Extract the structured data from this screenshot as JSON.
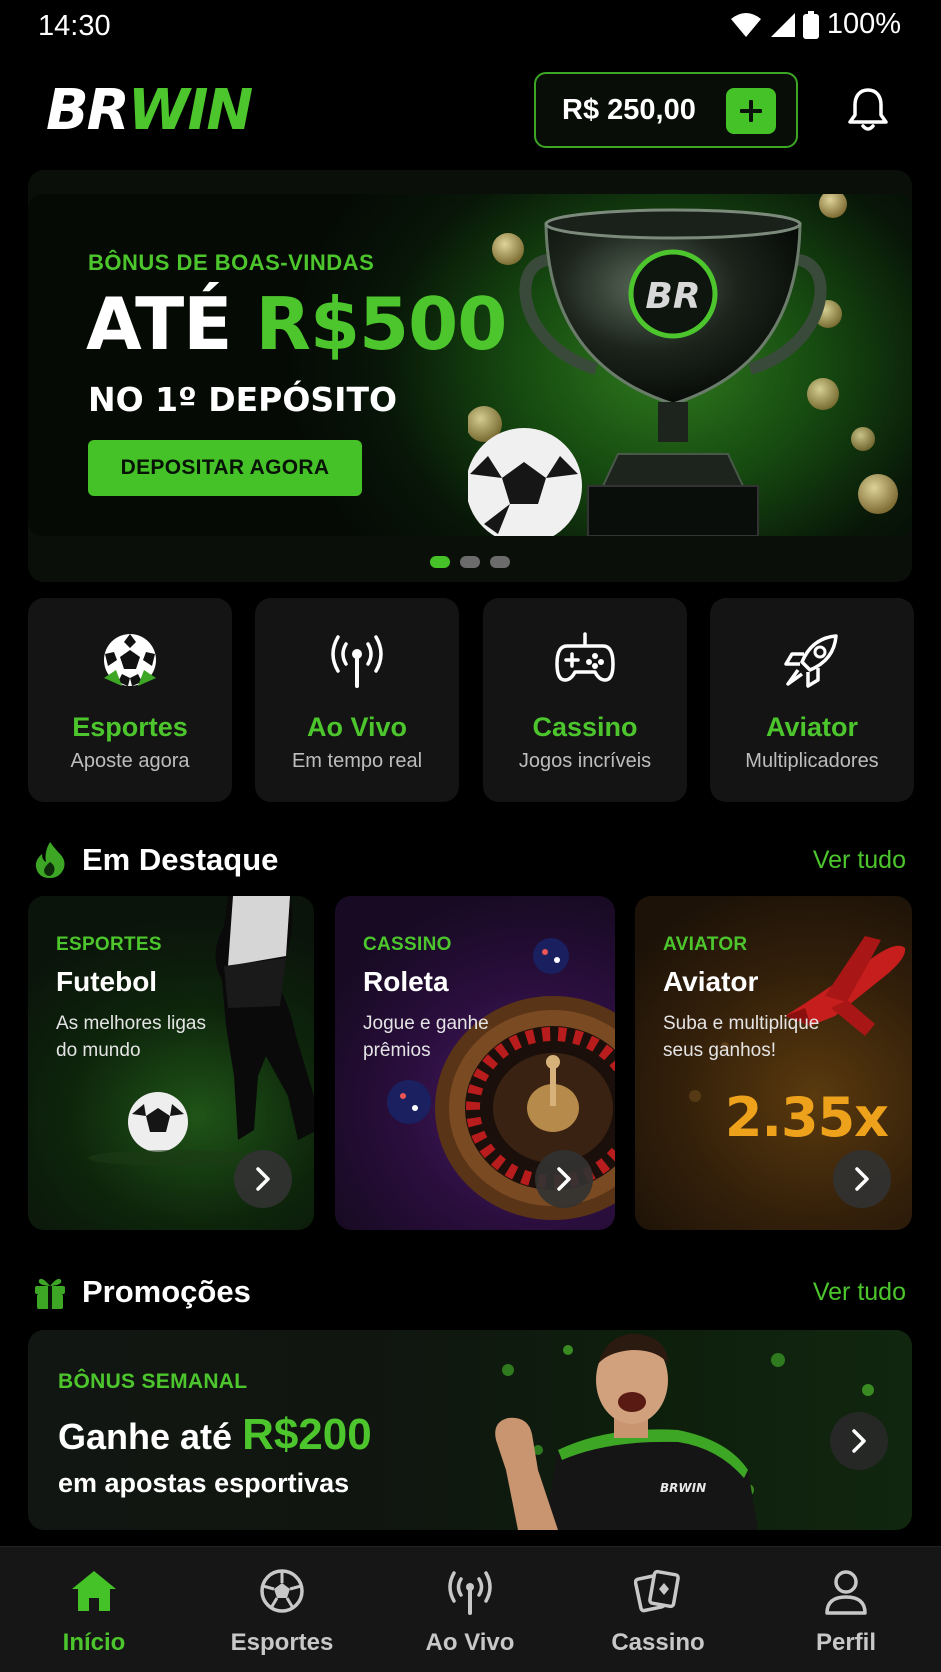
{
  "status_bar": {
    "time": "14:30",
    "battery": "100%"
  },
  "header": {
    "logo_part1": "BR",
    "logo_part2": "WIN",
    "balance": "R$ 250,00",
    "add_funds_label": "+",
    "notifications_icon": "bell-icon"
  },
  "hero": {
    "eyebrow": "BÔNUS DE BOAS-VINDAS",
    "headline_prefix": "ATÉ ",
    "headline_amount": "R$500",
    "subline": "NO 1º DEPÓSITO",
    "cta": "DEPOSITAR AGORA",
    "trophy_badge": "BR",
    "carousel": {
      "total": 3,
      "active": 1
    }
  },
  "categories": [
    {
      "name": "Esportes",
      "desc": "Aposte agora",
      "icon": "soccer-ball-icon"
    },
    {
      "name": "Ao Vivo",
      "desc": "Em tempo real",
      "icon": "broadcast-icon"
    },
    {
      "name": "Cassino",
      "desc": "Jogos incríveis",
      "icon": "gamepad-icon"
    },
    {
      "name": "Aviator",
      "desc": "Multiplicadores",
      "icon": "rocket-icon"
    }
  ],
  "featured": {
    "title": "Em Destaque",
    "see_all": "Ver tudo",
    "cards": [
      {
        "eyebrow": "ESPORTES",
        "title": "Futebol",
        "desc": "As melhores ligas do mundo"
      },
      {
        "eyebrow": "CASSINO",
        "title": "Roleta",
        "desc": "Jogue e ganhe prêmios"
      },
      {
        "eyebrow": "AVIATOR",
        "title": "Aviator",
        "desc": "Suba e multiplique seus ganhos!",
        "multiplier": "2.35x"
      }
    ]
  },
  "promotions": {
    "title": "Promoções",
    "see_all": "Ver tudo",
    "card": {
      "eyebrow": "BÔNUS SEMANAL",
      "title_prefix": "Ganhe até ",
      "title_amount": "R$200",
      "desc": "em apostas esportivas",
      "shirt_logo": "BRWIN"
    }
  },
  "bottom_nav": [
    {
      "label": "Início",
      "icon": "home-icon",
      "active": true
    },
    {
      "label": "Esportes",
      "icon": "soccer-ball-icon",
      "active": false
    },
    {
      "label": "Ao Vivo",
      "icon": "broadcast-icon",
      "active": false
    },
    {
      "label": "Cassino",
      "icon": "cards-icon",
      "active": false
    },
    {
      "label": "Perfil",
      "icon": "user-icon",
      "active": false
    }
  ],
  "colors": {
    "accent": "#4cc62c",
    "background": "#000000",
    "card": "#141414",
    "aviator_orange": "#eea21c"
  }
}
